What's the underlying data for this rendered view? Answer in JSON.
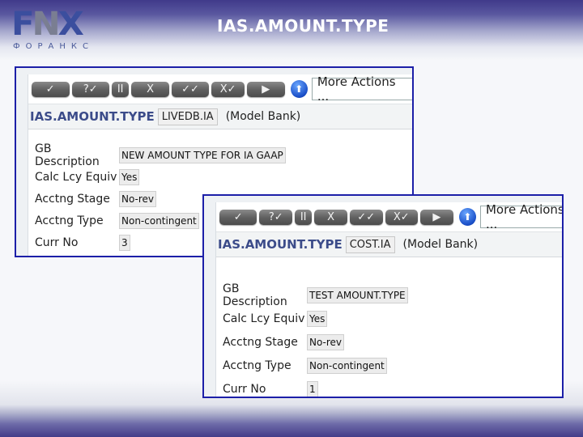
{
  "slide": {
    "title": "IAS.AMOUNT.TYPE",
    "logo": {
      "letters_a": "F",
      "letters_b": "N",
      "letters_c": "X",
      "subtitle": "ФОРАНКС"
    }
  },
  "toolbar": {
    "buttons": [
      {
        "name": "commit",
        "glyph": "✓"
      },
      {
        "name": "validate",
        "glyph": "?✓"
      },
      {
        "name": "hold",
        "glyph": "II"
      },
      {
        "name": "delete",
        "glyph": "X"
      },
      {
        "name": "authorise",
        "glyph": "✓✓"
      },
      {
        "name": "reverse",
        "glyph": "X✓"
      },
      {
        "name": "next",
        "glyph": "▶"
      }
    ],
    "up_glyph": "⬆",
    "more_actions": "More Actions ..."
  },
  "windows": [
    {
      "app": "IAS.AMOUNT.TYPE",
      "record_id": "LIVEDB.IA",
      "company": "(Model Bank)",
      "fields": [
        {
          "label": "GB Description",
          "value": "NEW AMOUNT TYPE FOR IA GAAP"
        },
        {
          "label": "Calc Lcy Equiv",
          "value": "Yes"
        },
        {
          "label": "Acctng Stage",
          "value": "No-rev"
        },
        {
          "label": "Acctng Type",
          "value": "Non-contingent"
        },
        {
          "label": "Curr No",
          "value": "3"
        }
      ]
    },
    {
      "app": "IAS.AMOUNT.TYPE",
      "record_id": "COST.IA",
      "company": "(Model Bank)",
      "fields": [
        {
          "label": "GB Description",
          "value": "TEST AMOUNT.TYPE"
        },
        {
          "label": "Calc Lcy Equiv",
          "value": "Yes"
        },
        {
          "label": "Acctng Stage",
          "value": "No-rev"
        },
        {
          "label": "Acctng Type",
          "value": "Non-contingent"
        },
        {
          "label": "Curr No",
          "value": "1"
        }
      ]
    }
  ]
}
